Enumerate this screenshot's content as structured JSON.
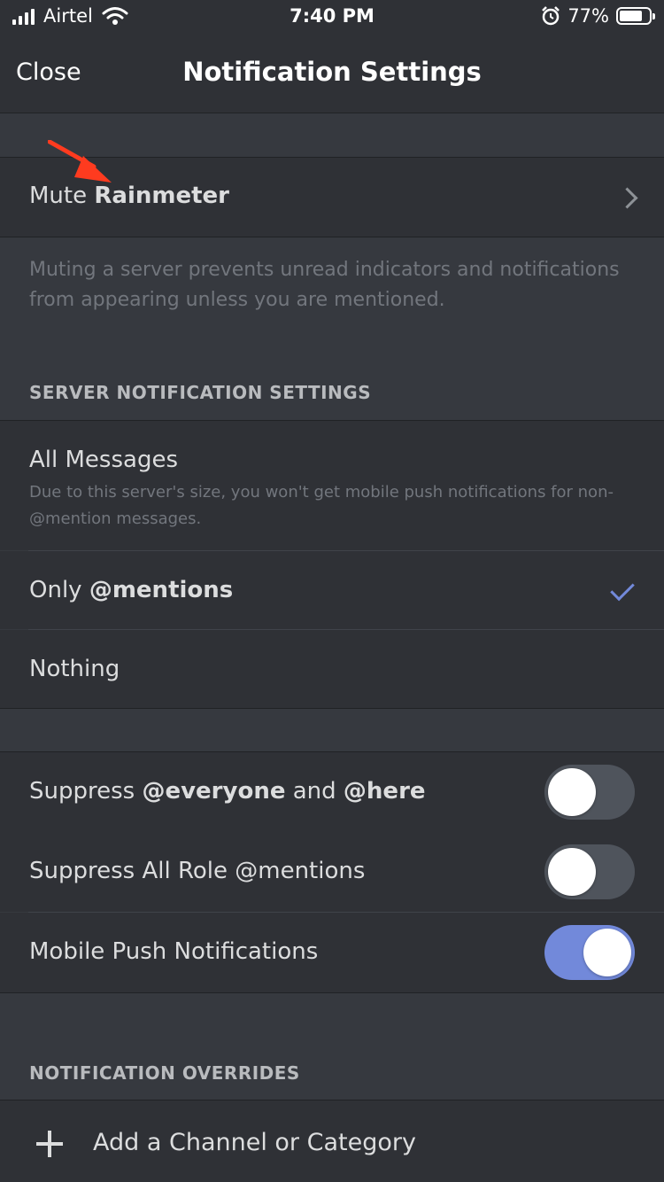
{
  "status_bar": {
    "carrier": "Airtel",
    "time": "7:40 PM",
    "battery": "77%",
    "battery_level": 0.77,
    "icons": [
      "signal-icon",
      "wifi-icon",
      "alarm-icon",
      "battery-icon"
    ]
  },
  "nav": {
    "close_label": "Close",
    "title": "Notification Settings"
  },
  "mute_row": {
    "prefix": "Mute ",
    "server_name": "Rainmeter",
    "icon": "chevron-right-icon"
  },
  "mute_help": "Muting a server prevents unread indicators and notifications from appearing unless you are mentioned.",
  "server_settings": {
    "header": "SERVER NOTIFICATION SETTINGS",
    "options": [
      {
        "label": "All Messages",
        "sub": "Due to this server's size, you won't get mobile push notifications for non-@mention messages.",
        "selected": false
      },
      {
        "label_prefix": "Only ",
        "label_bold": "@mentions",
        "selected": true
      },
      {
        "label": "Nothing",
        "selected": false
      }
    ]
  },
  "toggles": [
    {
      "parts": [
        "Suppress ",
        "@everyone",
        " and ",
        "@here"
      ],
      "on": false
    },
    {
      "label": "Suppress All Role @mentions",
      "on": false
    },
    {
      "label": "Mobile Push Notifications",
      "on": true
    }
  ],
  "overrides": {
    "header": "NOTIFICATION OVERRIDES",
    "add_label": "Add a Channel or Category",
    "icon": "plus-icon"
  },
  "colors": {
    "accent": "#7289da",
    "annotation_arrow": "#ff3b1f",
    "row_bg": "#2f3136",
    "page_bg": "#36393f"
  }
}
